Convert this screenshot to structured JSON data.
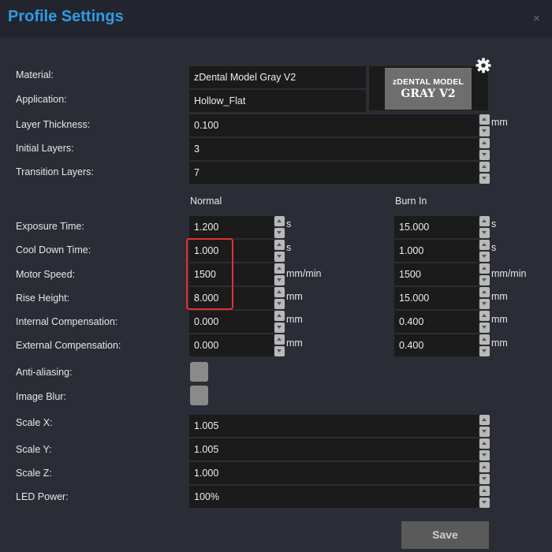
{
  "title": "Profile Settings",
  "close_glyph": "×",
  "material": {
    "label": "Material:",
    "value": "zDental Model Gray V2"
  },
  "application": {
    "label": "Application:",
    "value": "Hollow_Flat"
  },
  "logo": {
    "line1": "zDENTAL MODEL",
    "line2": "GRAY V2"
  },
  "layer_thickness": {
    "label": "Layer Thickness:",
    "value": "0.100",
    "unit": "mm"
  },
  "initial_layers": {
    "label": "Initial Layers:",
    "value": "3"
  },
  "transition_layers": {
    "label": "Transition Layers:",
    "value": "7"
  },
  "columns": {
    "normal": "Normal",
    "burn_in": "Burn In"
  },
  "exposure_time": {
    "label": "Exposure Time:",
    "normal": "1.200",
    "burn_in": "15.000",
    "unit": "s"
  },
  "cool_down_time": {
    "label": "Cool Down Time:",
    "normal": "1.000",
    "burn_in": "1.000",
    "unit": "s"
  },
  "motor_speed": {
    "label": "Motor Speed:",
    "normal": "1500",
    "burn_in": "1500",
    "unit": "mm/min"
  },
  "rise_height": {
    "label": "Rise Height:",
    "normal": "8.000",
    "burn_in": "15.000",
    "unit": "mm"
  },
  "internal_compensation": {
    "label": "Internal Compensation:",
    "normal": "0.000",
    "burn_in": "0.400",
    "unit": "mm"
  },
  "external_compensation": {
    "label": "External Compensation:",
    "normal": "0.000",
    "burn_in": "0.400",
    "unit": "mm"
  },
  "anti_aliasing": {
    "label": "Anti-aliasing:"
  },
  "image_blur": {
    "label": "Image Blur:"
  },
  "scale_x": {
    "label": "Scale X:",
    "value": "1.005"
  },
  "scale_y": {
    "label": "Scale Y:",
    "value": "1.005"
  },
  "scale_z": {
    "label": "Scale Z:",
    "value": "1.000"
  },
  "led_power": {
    "label": "LED Power:",
    "value": "100%"
  },
  "save_label": "Save",
  "colors": {
    "title": "#2e9be6",
    "highlight": "#e33030",
    "background": "#2b2d36"
  },
  "icons": {
    "settings": "gear-icon",
    "close": "close-icon"
  }
}
